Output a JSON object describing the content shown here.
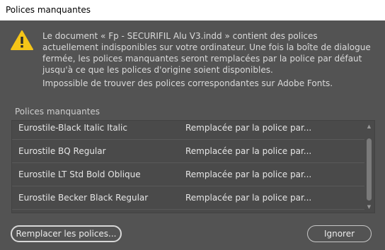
{
  "dialog": {
    "title": "Polices manquantes",
    "message": "Le document « Fp - SECURIFIL Alu V3.indd » contient des polices actuellement indisponibles sur votre ordinateur. Une fois la boîte de dialogue fermée, les polices manquantes seront remplacées par la police par défaut jusqu'à ce que les polices d'origine soient disponibles.",
    "message2": "Impossible de trouver des polices correspondantes sur Adobe Fonts.",
    "list_label": "Polices manquantes",
    "fonts": [
      {
        "name": "Eurostile-Black Italic Italic",
        "status": "Remplacée par la police par..."
      },
      {
        "name": "Eurostile BQ Regular",
        "status": "Remplacée par la police par..."
      },
      {
        "name": "Eurostile LT Std Bold Oblique",
        "status": "Remplacée par la police par..."
      },
      {
        "name": "Eurostile Becker Black Regular",
        "status": "Remplacée par la police par..."
      }
    ],
    "buttons": {
      "replace": "Remplacer les polices...",
      "ignore": "Ignorer"
    },
    "icon": "warning-icon",
    "colors": {
      "warning": "#f5c518",
      "background": "#535353"
    }
  }
}
